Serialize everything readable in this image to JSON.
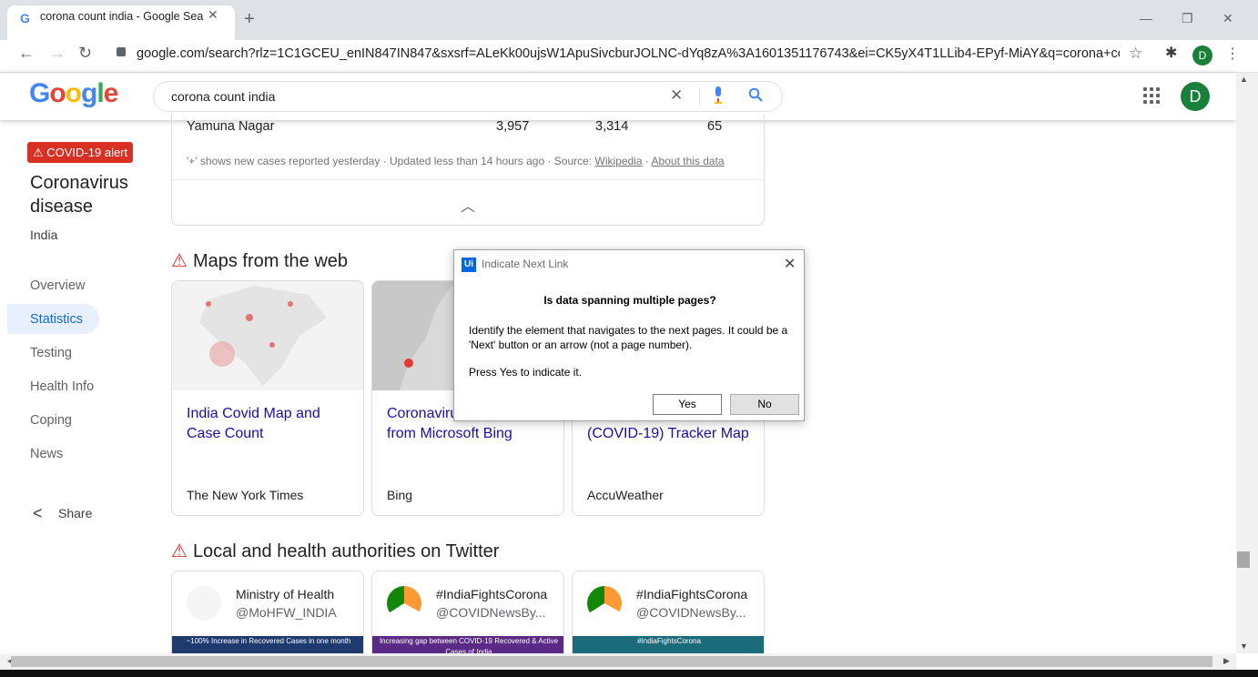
{
  "browser": {
    "tab_title": "corona count india - Google Search",
    "tab_favicon": "G",
    "new_tab": "+",
    "url": "google.com/search?rlz=1C1GCEU_enIN847IN847&sxsrf=ALeKk00ujsW1ApuSivcburJOLNC-dYq8zA%3A1601351176743&ei=CK5yX4T1LLib4-EPyf-MiAY&q=corona+count+in...",
    "profile_initial": "D",
    "icons": [
      "back-icon",
      "forward-icon",
      "reload-icon",
      "lock-icon",
      "star-icon",
      "extensions-icon",
      "kebab-menu-icon",
      "minimize-icon",
      "restore-icon",
      "close-icon"
    ]
  },
  "google": {
    "logo": "Google",
    "query": "corona count india",
    "profile_initial": "D"
  },
  "sidebar": {
    "alert": "⚠ COVID-19 alert",
    "title": "Coronavirus disease",
    "region": "India",
    "nav": [
      "Overview",
      "Statistics",
      "Testing",
      "Health Info",
      "Coping",
      "News"
    ],
    "selected": "Statistics",
    "share": "Share"
  },
  "table": {
    "last_row": {
      "name": "Yamuna Nagar",
      "cases": "3,957",
      "recovered": "3,314",
      "deaths": "65"
    },
    "footnote": "'+' shows new cases reported yesterday · Updated less than 14 hours ago  ·  Source: ",
    "source_link": "Wikipedia",
    "about_link": "About this data"
  },
  "maps": {
    "heading": "Maps from the web",
    "cards": [
      {
        "title": "India Covid Map and Case Count",
        "source": "The New York Times"
      },
      {
        "title": "Coronavirus map tracker from Microsoft Bing",
        "source": "Bing"
      },
      {
        "title": "(COVID-19) Tracker Map",
        "source": "AccuWeather"
      }
    ]
  },
  "twitter": {
    "heading": "Local and health authorities on Twitter",
    "cards": [
      {
        "name": "Ministry of Health",
        "handle": "@MoHFW_INDIA",
        "banner": "~100% Increase in Recovered Cases in one month",
        "banner_color": "#1f3a6e"
      },
      {
        "name": "#IndiaFightsCorona",
        "handle": "@COVIDNewsBy...",
        "banner": "Increasing gap between COVID-19 Recovered & Active Cases of India",
        "banner_color": "#5b2a86"
      },
      {
        "name": "#IndiaFightsCorona",
        "handle": "@COVIDNewsBy...",
        "banner": "#IndiaFightsCorona",
        "banner_color": "#1b6b7a"
      }
    ]
  },
  "dialog": {
    "app_icon": "Ui",
    "title": "Indicate Next Link",
    "question": "Is data spanning multiple pages?",
    "body": "Identify the element that navigates to the next pages. It could be a 'Next' button or an arrow (not a page number).",
    "instruction": "Press Yes to indicate it.",
    "yes": "Yes",
    "no": "No"
  },
  "colors": {
    "alert_red": "#d93025",
    "link_blue": "#1a0dab",
    "accent_green": "#188038",
    "uipath_blue": "#0067df"
  }
}
